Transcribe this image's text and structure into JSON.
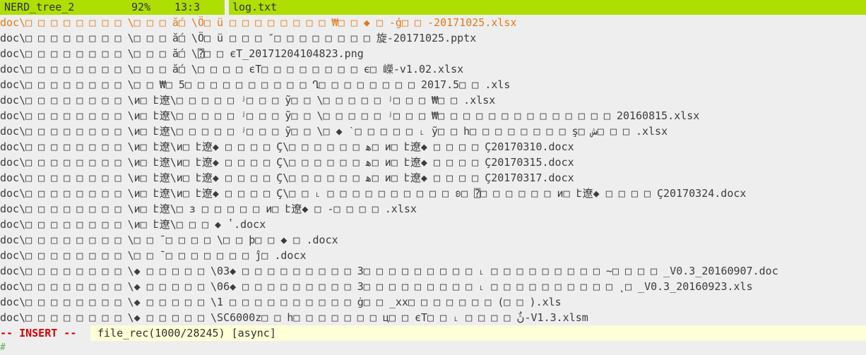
{
  "topbar": {
    "buffer_name": "NERD_tree_2",
    "percent": "92%",
    "position": "13:3",
    "file_name": "log.txt"
  },
  "lines": [
    "doc\\□ □ □ □ □ □ □ □ \\□ □ □ ắ□ \\Ö□ ü □ □ □ □ □ □ □ □ ₩□ □ ◆ □ -ģ□ □ -20171025.xlsx",
    "doc\\□ □ □ □ □ □ □ □ \\□ □ □ ắ□ \\Ö□ ü □ □ □ ″□ □ □ □ □ □ □ □ 旋-20171025.pptx",
    "doc\\□ □ □ □ □ □ □ □ \\□ □ □ ắ□ \\⍰□ □ єТ_20171204104823.png",
    "doc\\□ □ □ □ □ □ □ □ \\□ □ □ ắ□ \\□ □ □ □ єТ□ □ □ □ □ □ □ □ є□ 嶸-v1.02.xlsx",
    "doc\\□ □ □ □ □ □ □ □ \\□ □ ₩□ 5□ □ □ □ □ □ □ □ □ □ Ղ□ □ □ □ □ □ □ □ 2017.5□ □ .xls",
    "doc\\□ □ □ □ □ □ □ □ \\и□ է遼\\□ □ □ □ □ ʲ□ □ □ ỹ□ □ \\□ □ □ □ □ ʲ□ □ □ ₩□ □ .xlsx",
    "doc\\□ □ □ □ □ □ □ □ \\и□ է遼\\□ □ □ □ □ ʲ□ □ □ ỹ□ □ \\□ □ □ □ □ ʲ□ □ □ ₩□ □ □ □ □ □ □ □ □ □ □ □ □ □ 20160815.xlsx",
    "doc\\□ □ □ □ □ □ □ □ \\и□ է遼\\□ □ □ □ □ ʲ□ □ □ ỹ□ □ \\□ ◆ ˋ□ □ □ □ □ ˪ ỹ□ □ һ□ □ □ □ □ □ □ □ ş□ ش□ □ □ .xlsx",
    "doc\\□ □ □ □ □ □ □ □ \\и□ է遼\\и□ է遼◆ □ □ □ □ Ç\\□ □ □ □ □ □ ﻫ□ и□ է遼◆ □ □ □ □ Ç20170310.docx",
    "doc\\□ □ □ □ □ □ □ □ \\и□ է遼\\и□ է遼◆ □ □ □ □ Ç\\□ □ □ □ □ □ ﻫ□ и□ է遼◆ □ □ □ □ Ç20170315.docx",
    "doc\\□ □ □ □ □ □ □ □ \\и□ է遼\\и□ է遼◆ □ □ □ □ Ç\\□ □ □ □ □ □ ﻫ□ и□ է遼◆ □ □ □ □ Ç20170317.docx",
    "doc\\□ □ □ □ □ □ □ □ \\и□ է遼\\и□ է遼◆ □ □ □ □ Ç\\□ □ ˪ □ □ □ □ □ □ □ □ □ □ ʚ□ ⍰□ □ □ □ □ □ и□ է遼◆ □ □ □ □ Ç20170324.docx",
    "doc\\□ □ □ □ □ □ □ □ \\и□ է遼\\□ з □ □ □ □ □ и□ է遼◆ □ -□ □ □ □ .xlsx",
    "doc\\□ □ □ □ □ □ □ □ \\и□ է遼\\□ □ □ ◆ ʽ.docx",
    "doc\\□ □ □ □ □ □ □ □ \\□ □ ˉ□ □ □ □ \\□ □ þ□ □ ◆ □ .docx",
    "doc\\□ □ □ □ □ □ □ □ \\□ □ ˉ□ □ □ □ □ □ □ ĵ□ .docx",
    "doc\\□ □ □ □ □ □ □ □ \\◆ □ □ □ □ □ \\03◆ □ □ □ □ □ □ □ □ □ 3□ □ □ □ □ □ □ □ □ ˪ □ □ □ □ □ □ □ □ □ ~□ □ □ □ _V0.3_20160907.doc",
    "doc\\□ □ □ □ □ □ □ □ \\◆ □ □ □ □ □ \\06◆ □ □ □ □ □ □ □ □ □ 3□ □ □ □ □ □ □ □ □ ˪ □ □ □ □ □ □ □ □ □ □ ˛□ _V0.3_20160923.xls",
    "doc\\□ □ □ □ □ □ □ □ \\◆ □ □ □ □ □ \\1 □ □ □ □ □ □ □ □ □ □ ġ□ □ _xx□ □ □ □ □ □ □ (□ □ ).xls",
    "doc\\□ □ □ □ □ □ □ □ \\◆ □ □ □ □ □ \\SC6000z□ □ һ□ □ □ □ □ □ □ ц□ □ єТ□ □ ˪ □ □ □ □ ڽٌ-V1.3.xlsm"
  ],
  "statusline": {
    "mode": "-- INSERT --",
    "input": "file_rec(1000/28245) [async]"
  },
  "prompt": {
    "symbol": "#"
  },
  "colors": {
    "topbar_bg": "#afdf00",
    "background": "#eeeeee",
    "first_line": "#e07a18",
    "insert_mode": "#d70000",
    "input_bg": "#ffffd7"
  }
}
